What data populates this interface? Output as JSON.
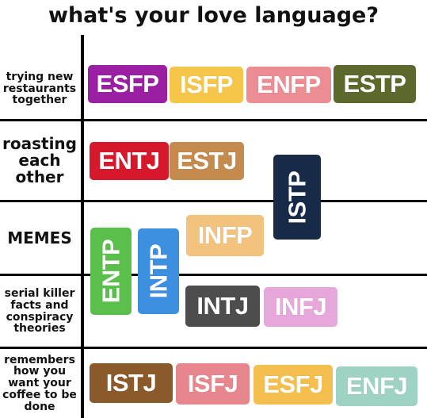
{
  "title": "what's your love language?",
  "rows": [
    {
      "label": "trying new restaurants together"
    },
    {
      "label": "roasting each other"
    },
    {
      "label": "MEMES"
    },
    {
      "label": "serial killer facts and conspiracy theories"
    },
    {
      "label": "remembers how you want your coffee to be done"
    }
  ],
  "tags": {
    "esfp": {
      "text": "ESFP",
      "color": "#9b1fa3"
    },
    "isfp": {
      "text": "ISFP",
      "color": "#f5c64a"
    },
    "enfp": {
      "text": "ENFP",
      "color": "#ec8d94"
    },
    "estp": {
      "text": "ESTP",
      "color": "#5b6a2c"
    },
    "entj": {
      "text": "ENTJ",
      "color": "#d6182c"
    },
    "estj": {
      "text": "ESTJ",
      "color": "#c48a4e"
    },
    "istp": {
      "text": "ISTP",
      "color": "#172a47"
    },
    "infp": {
      "text": "INFP",
      "color": "#f3c27e"
    },
    "entp": {
      "text": "ENTP",
      "color": "#5bbf4c"
    },
    "intp": {
      "text": "INTP",
      "color": "#3d8fe0"
    },
    "intj": {
      "text": "INTJ",
      "color": "#4d4d4d"
    },
    "infj": {
      "text": "INFJ",
      "color": "#e6a8da"
    },
    "istj": {
      "text": "ISTJ",
      "color": "#8a5a2a"
    },
    "isfj": {
      "text": "ISFJ",
      "color": "#e7878d"
    },
    "esfj": {
      "text": "ESFJ",
      "color": "#f4bf4e"
    },
    "enfj": {
      "text": "ENFJ",
      "color": "#9ed2c3"
    }
  }
}
